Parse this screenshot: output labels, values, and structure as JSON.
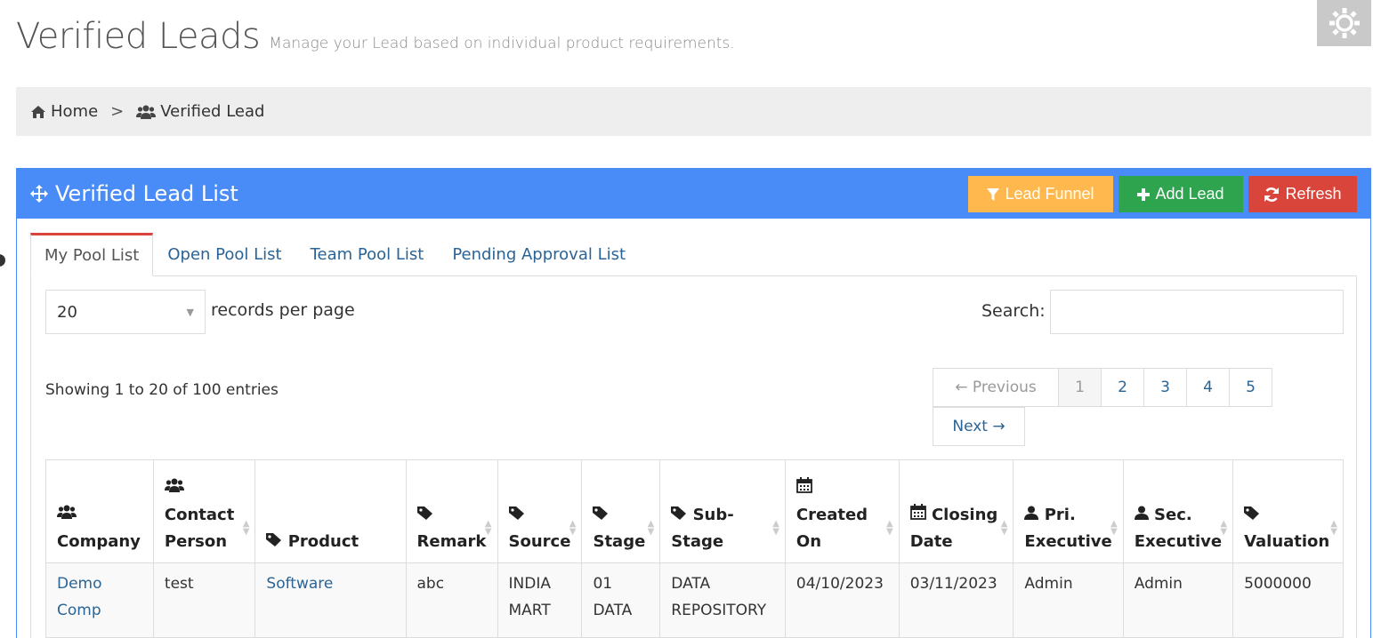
{
  "header": {
    "title": "Verified Leads",
    "subtitle": "Manage your Lead based on individual product requirements."
  },
  "breadcrumb": {
    "home": "Home",
    "current": "Verified Lead"
  },
  "panel": {
    "title": "Verified Lead List",
    "buttons": {
      "funnel": "Lead Funnel",
      "add": "Add Lead",
      "refresh": "Refresh"
    },
    "colors": {
      "heading": "#4a8cf7",
      "funnel": "#ffb84d",
      "add": "#2ea44f",
      "refresh": "#d9453a"
    }
  },
  "tabs": [
    {
      "label": "My Pool List",
      "active": true
    },
    {
      "label": "Open Pool List",
      "active": false
    },
    {
      "label": "Team Pool List",
      "active": false
    },
    {
      "label": "Pending Approval List",
      "active": false
    }
  ],
  "table_controls": {
    "records_per_page_value": "20",
    "records_per_page_label": "records per page",
    "search_label": "Search:",
    "search_value": "",
    "info": "Showing 1 to 20 of 100 entries"
  },
  "pagination": {
    "previous": "← Previous",
    "pages": [
      "1",
      "2",
      "3",
      "4",
      "5"
    ],
    "current_page": "1",
    "next": "Next →"
  },
  "columns": [
    {
      "icon": "users-icon",
      "label": "Company"
    },
    {
      "icon": "users-icon",
      "label": "Contact Person"
    },
    {
      "icon": "tag-icon",
      "label": "Product"
    },
    {
      "icon": "tag-icon",
      "label": "Remark"
    },
    {
      "icon": "tag-icon",
      "label": "Source"
    },
    {
      "icon": "tag-icon",
      "label": "Stage"
    },
    {
      "icon": "tag-icon",
      "label": "Sub-Stage"
    },
    {
      "icon": "calendar-icon",
      "label": "Created On"
    },
    {
      "icon": "calendar-icon",
      "label": "Closing Date"
    },
    {
      "icon": "user-icon",
      "label": "Pri. Executive"
    },
    {
      "icon": "user-icon",
      "label": "Sec. Executive"
    },
    {
      "icon": "tag-icon",
      "label": "Valuation"
    }
  ],
  "rows": [
    {
      "company": "Demo Comp",
      "contact_person": "test",
      "product": "Software",
      "remark": "abc",
      "source": "INDIA MART",
      "stage": "01 DATA",
      "sub_stage": "DATA REPOSITORY",
      "created_on": "04/10/2023",
      "closing_date": "03/11/2023",
      "pri_executive": "Admin",
      "sec_executive": "Admin",
      "valuation": "5000000"
    }
  ]
}
